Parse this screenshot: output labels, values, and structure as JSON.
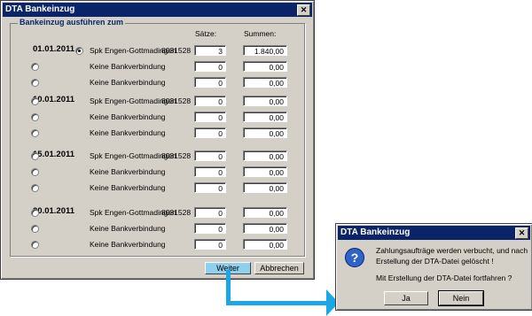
{
  "main_dialog": {
    "title": "DTA Bankeinzug",
    "group_label": "Bankeinzug ausführen zum",
    "col_saetze": "Sätze:",
    "col_summen": "Summen:",
    "sections": [
      {
        "date": "01.01.2011",
        "rows": [
          {
            "selected": true,
            "bank": "Spk Engen-Gottmadingen",
            "blz": "8031528",
            "saetze": "3",
            "summe": "1.840,00"
          },
          {
            "selected": false,
            "bank": "Keine Bankverbindung",
            "blz": "",
            "saetze": "0",
            "summe": "0,00"
          },
          {
            "selected": false,
            "bank": "Keine Bankverbindung",
            "blz": "",
            "saetze": "0",
            "summe": "0,00"
          }
        ]
      },
      {
        "date": "10.01.2011",
        "rows": [
          {
            "selected": false,
            "bank": "Spk Engen-Gottmadingen",
            "blz": "8031528",
            "saetze": "0",
            "summe": "0,00"
          },
          {
            "selected": false,
            "bank": "Keine Bankverbindung",
            "blz": "",
            "saetze": "0",
            "summe": "0,00"
          },
          {
            "selected": false,
            "bank": "Keine Bankverbindung",
            "blz": "",
            "saetze": "0",
            "summe": "0,00"
          }
        ]
      },
      {
        "date": "15.01.2011",
        "rows": [
          {
            "selected": false,
            "bank": "Spk Engen-Gottmadingen",
            "blz": "8031528",
            "saetze": "0",
            "summe": "0,00"
          },
          {
            "selected": false,
            "bank": "Keine Bankverbindung",
            "blz": "",
            "saetze": "0",
            "summe": "0,00"
          },
          {
            "selected": false,
            "bank": "Keine Bankverbindung",
            "blz": "",
            "saetze": "0",
            "summe": "0,00"
          }
        ]
      },
      {
        "date": "20.01.2011",
        "rows": [
          {
            "selected": false,
            "bank": "Spk Engen-Gottmadingen",
            "blz": "8031528",
            "saetze": "0",
            "summe": "0,00"
          },
          {
            "selected": false,
            "bank": "Keine Bankverbindung",
            "blz": "",
            "saetze": "0",
            "summe": "0,00"
          },
          {
            "selected": false,
            "bank": "Keine Bankverbindung",
            "blz": "",
            "saetze": "0",
            "summe": "0,00"
          }
        ]
      }
    ],
    "weiter_label": "Weiter",
    "abbrechen_label": "Abbrechen"
  },
  "confirm_dialog": {
    "title": "DTA Bankeinzug",
    "message_line1": "Zahlungsaufträge werden verbucht, und nach",
    "message_line2": "Erstellung der DTA-Datei gelöscht !",
    "question": "Mit Erstellung der DTA-Datei fortfahren ?",
    "yes_label": "Ja",
    "no_label": "Nein",
    "icon": "question-icon"
  },
  "colors": {
    "title_bar": "#0a246a",
    "arrow": "#1aa7e8",
    "dialog_bg": "#d4d0c8"
  }
}
